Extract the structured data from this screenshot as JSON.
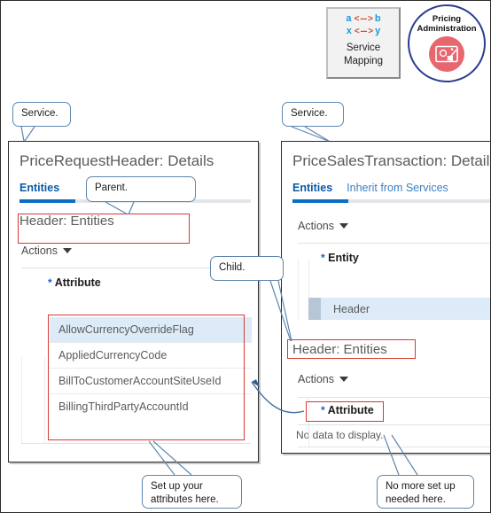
{
  "top_icons": {
    "service_mapping": {
      "code_line_1_left": "a",
      "code_line_1_op": "< --- >",
      "code_line_1_right": "b",
      "code_line_2_left": "x",
      "code_line_2_op": "< --- >",
      "code_line_2_right": "y",
      "label_line_1": "Service",
      "label_line_2": "Mapping",
      "icon": "service-mapping-tile"
    },
    "pricing_administration": {
      "title_line_1": "Pricing",
      "title_line_2": "Administration",
      "icon": "pricing-administration-icon"
    }
  },
  "left_panel": {
    "title": "PriceRequestHeader: Details",
    "tabs": [
      {
        "label": "Entities",
        "active": true
      }
    ],
    "subheader": "Header: Entities",
    "actions_label": "Actions",
    "column_header": "Attribute",
    "required_marker": "*",
    "attributes": [
      {
        "name": "AllowCurrencyOverrideFlag",
        "selected": true
      },
      {
        "name": "AppliedCurrencyCode",
        "selected": false
      },
      {
        "name": "BillToCustomerAccountSiteUseId",
        "selected": false
      },
      {
        "name": "BillingThirdPartyAccountId",
        "selected": false
      }
    ]
  },
  "right_panel": {
    "title": "PriceSalesTransaction: Details",
    "tabs": [
      {
        "label": "Entities",
        "active": true
      },
      {
        "label": "Inherit from Services",
        "active": false
      }
    ],
    "actions_label_top": "Actions",
    "entity_column_header": "Entity",
    "required_marker": "*",
    "entity_rows": [
      {
        "name": "Header",
        "selected": true
      }
    ],
    "subheader": "Header: Entities",
    "actions_label_bottom": "Actions",
    "attribute_column_header": "Attribute",
    "no_data_text": "No data to display."
  },
  "callouts": {
    "service_left": "Service.",
    "service_right": "Service.",
    "parent": "Parent.",
    "child": "Child.",
    "set_up_attributes_line_1": "Set up your",
    "set_up_attributes_line_2": "attributes here.",
    "no_more_setup_line_1": "No more set up",
    "no_more_setup_line_2": "needed here."
  },
  "colors": {
    "accent_blue": "#0a6ec4",
    "link_blue": "#3b7fc4",
    "callout_border": "#5f87ad",
    "highlight_red": "#d23a33",
    "row_selected": "#dcebf7",
    "badge_red": "#e8666e",
    "badge_ring": "#2a3d8f"
  }
}
